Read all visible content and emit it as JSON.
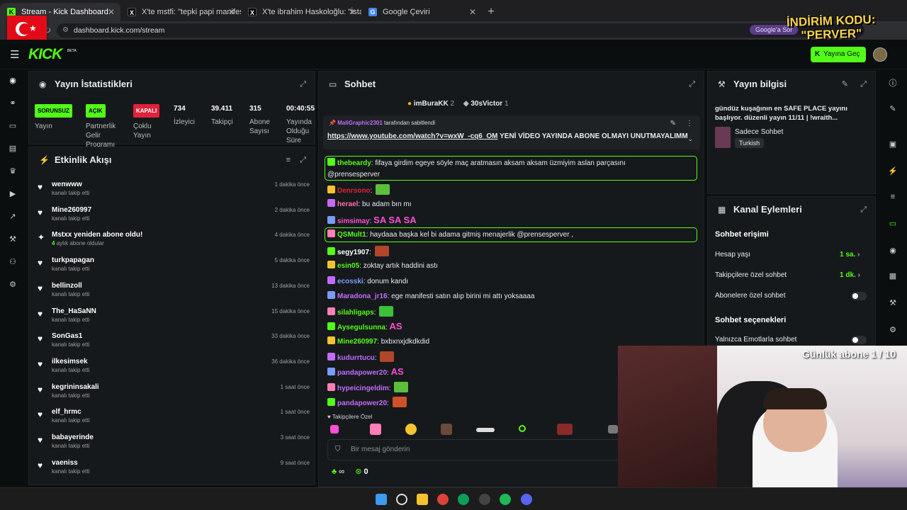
{
  "browser": {
    "tabs": [
      {
        "title": "Stream - Kick Dashboard",
        "active": true
      },
      {
        "title": "X'te mstfi: \"tepki papi manifestin"
      },
      {
        "title": "X'te ibrahim Haskoloğlu: \"İstan"
      },
      {
        "title": "Google Çeviri"
      }
    ],
    "new_tab": "+",
    "url": "dashboard.kick.com/stream",
    "google_pill": "Google'a Sor"
  },
  "overlay": {
    "promo": "İNDİRİM KODU:\n\"PERVER\"",
    "sub_goal": "Günlük abone 1 / 10"
  },
  "header": {
    "logo": "KICK",
    "beta": "BETA",
    "go_live": "Yayına Geç"
  },
  "stats": {
    "title": "Yayın İstatistikleri",
    "items": [
      {
        "badge": "SORUNSUZ",
        "badge_color": "#53fc18",
        "label": "Yayın"
      },
      {
        "badge": "AÇIK",
        "badge_color": "#53fc18",
        "label": "Partnerlik Gelir Programı"
      },
      {
        "badge": "KAPALI",
        "badge_color": "#e0223a",
        "label": "Çoklu Yayın"
      },
      {
        "value": "734",
        "label": "İzleyici"
      },
      {
        "value": "39.411",
        "label": "Takipçi"
      },
      {
        "value": "315",
        "label": "Abone Sayısı"
      },
      {
        "value": "00:40:55",
        "label": "Yayında Olduğu Süre"
      }
    ]
  },
  "activity": {
    "title": "Etkinlik Akışı",
    "items": [
      {
        "name": "wenwww",
        "sub": "kanalı takip etti",
        "time": "1 dakika önce"
      },
      {
        "name": "Mine260997",
        "sub": "kanalı takip etti",
        "time": "2 dakika önce"
      },
      {
        "name": "Mstxx yeniden abone oldu!",
        "sub_num": "4",
        "sub": "aylık abone oldular",
        "time": "4 dakika önce",
        "type": "sub"
      },
      {
        "name": "turkpapagan",
        "sub": "kanalı takip etti",
        "time": "5 dakika önce"
      },
      {
        "name": "bellinzoll",
        "sub": "kanalı takip etti",
        "time": "13 dakika önce"
      },
      {
        "name": "The_HaSaNN",
        "sub": "kanalı takip etti",
        "time": "15 dakika önce"
      },
      {
        "name": "SonGas1",
        "sub": "kanalı takip etti",
        "time": "33 dakika önce"
      },
      {
        "name": "ilkesimsek",
        "sub": "kanalı takip etti",
        "time": "36 dakika önce"
      },
      {
        "name": "kegrininsakali",
        "sub": "kanalı takip etti",
        "time": "1 saat önce"
      },
      {
        "name": "elf_hrmc",
        "sub": "kanalı takip etti",
        "time": "1 saat önce"
      },
      {
        "name": "babayerinde",
        "sub": "kanalı takip etti",
        "time": "3 saat önce"
      },
      {
        "name": "vaeniss",
        "sub": "kanalı takip etti",
        "time": "9 saat önce"
      }
    ]
  },
  "chat": {
    "title": "Sohbet",
    "top_gifters": [
      {
        "name": "imBuraKK",
        "count": "2"
      },
      {
        "name": "30sVictor",
        "count": "1"
      }
    ],
    "pinned_by": "MaliGraphic2301",
    "pinned_by_suffix": "tarafından sabitlendi",
    "pinned_link": "https://www.youtube.com/watch?v=wxW_-cq6_OM",
    "pinned_text": " YENİ VİDEO YAYINDA ABONE OLMAYI UNUTMAYALIMM",
    "messages": [
      {
        "user": "thebeardy",
        "color": "#53fc18",
        "text": "fifaya girdim egeye söyle maç aratmasın aksam aksam üzmiyim aslan parçasını",
        "text2": "@prensesperver",
        "highlight": true
      },
      {
        "user": "Denrsono",
        "color": "#e0223a",
        "text": "",
        "emote": "#5cbf3a"
      },
      {
        "user": "herael",
        "color": "#ff6fa8",
        "text": "bu adam bın mı"
      },
      {
        "user": "simsimay",
        "color": "#ff4fd8",
        "text": "",
        "emote_text": "SA SA SA"
      },
      {
        "user": "QSMult1",
        "color": "#53fc18",
        "text": "haydaaa başka kel bi adama gitmiş menajerlik @prensesperver ,",
        "highlight": true
      },
      {
        "user": "segy1907",
        "color": "#ffffff",
        "text": "",
        "emote": "#b0462a"
      },
      {
        "user": "esin05",
        "color": "#53fc18",
        "text": "zoktay artık haddini astı"
      },
      {
        "user": "ecosski",
        "color": "#7a9cff",
        "text": "donum kandı"
      },
      {
        "user": "Maradona_jr16",
        "color": "#c46bff",
        "text": "ege manifesti satın alıp birini mi attı yoksaaaa"
      },
      {
        "user": "silahligaps",
        "color": "#53fc18",
        "text": "",
        "emote": "#3cbf3a"
      },
      {
        "user": "Aysegulsunna",
        "color": "#53fc18",
        "text": "",
        "emote_text": "AS"
      },
      {
        "user": "Mine260997",
        "color": "#53fc18",
        "text": "bxbxnxjdkdkdid"
      },
      {
        "user": "kudurrtucu",
        "color": "#c46bff",
        "text": "",
        "emote": "#b0462a"
      },
      {
        "user": "pandapower20",
        "color": "#c46bff",
        "text": "",
        "emote_text": "AS"
      },
      {
        "user": "hypeicingeldim",
        "color": "#c46bff",
        "text": "",
        "emote": "#5cbf3a"
      },
      {
        "user": "pandapower20",
        "color": "#c46bff",
        "text": "",
        "emote": "#d0502a"
      }
    ],
    "followers_only_label": "Takipçilere Özel",
    "input_placeholder": "Bir mesaj gönderin",
    "footer_infinity": "∞",
    "footer_count": "0"
  },
  "stream_info": {
    "title": "Yayın bilgisi",
    "description": "gündüz kuşağının en SAFE PLACE yayını başlıyor. düzenli yayın 11/11 | !wraith...",
    "category": "Sadece Sohbet",
    "tag": "Turkish"
  },
  "channel_actions": {
    "title": "Kanal Eylemleri",
    "access_title": "Sohbet erişimi",
    "account_age_label": "Hesap yaşı",
    "account_age_value": "1 sa.",
    "follower_chat_label": "Takipçilere özel sohbet",
    "follower_chat_value": "1 dk.",
    "sub_chat_label": "Abonelere özel sohbet",
    "options_title": "Sohbet seçenekleri",
    "emote_only_label": "Yalnızca Emotlarla sohbet"
  },
  "colors": {
    "accent": "#53fc18",
    "panel": "#16191b",
    "bg": "#0b0e0f"
  }
}
